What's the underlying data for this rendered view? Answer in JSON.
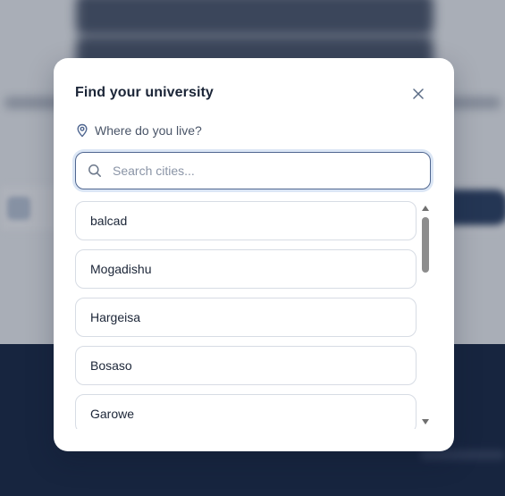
{
  "modal": {
    "title": "Find your university",
    "location_label": "Where do you live?",
    "search": {
      "placeholder": "Search cities...",
      "value": ""
    },
    "cities": [
      "balcad",
      "Mogadishu",
      "Hargeisa",
      "Bosaso",
      "Garowe"
    ]
  },
  "colors": {
    "accent_border": "#4f6690",
    "title_text": "#1b2537",
    "footer_bg": "#0f1f3d"
  },
  "icons": {
    "close": "close-icon",
    "location": "map-pin-icon",
    "search": "search-icon"
  }
}
